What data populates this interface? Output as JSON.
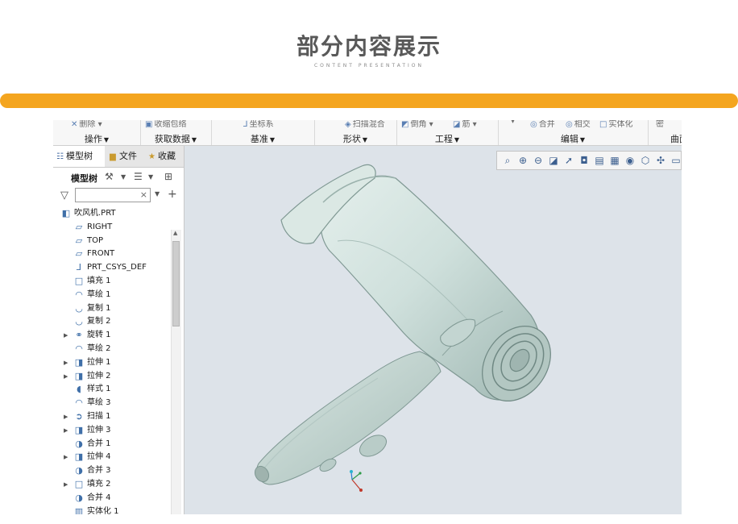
{
  "header": {
    "title": "部分内容展示",
    "subtitle": "CONTENT PRESENTATION",
    "accent_color": "#f4a51f"
  },
  "ribbon": {
    "groups": [
      {
        "label": "操作",
        "command": "删除",
        "icon": "delete-icon"
      },
      {
        "label": "获取数据",
        "command": "收缩包络",
        "icon": "shrinkwrap-icon"
      },
      {
        "label": "基准",
        "command": "坐标系",
        "icon": "csys-icon"
      },
      {
        "label": "形状",
        "command": "扫描混合",
        "icon": "swept-blend-icon"
      },
      {
        "label": "工程",
        "command": "倒角",
        "icon": "chamfer-icon",
        "command2": "筋",
        "icon2": "rib-icon"
      },
      {
        "label": "编辑",
        "command": "合并",
        "icon": "merge-icon",
        "command2": "相交",
        "icon2": "intersect-icon",
        "command3": "实体化",
        "icon3": "solidify-icon"
      },
      {
        "label": "曲面",
        "command": "密",
        "icon": "surface-icon"
      }
    ]
  },
  "panel": {
    "tabs": [
      {
        "label": "模型树",
        "icon": "model-tree-icon",
        "active": true
      },
      {
        "label": "文件",
        "icon": "folder-icon",
        "active": false
      },
      {
        "label": "收藏",
        "icon": "favorites-icon",
        "active": false
      }
    ],
    "tree_label": "模型树",
    "search": {
      "value": "",
      "placeholder": ""
    }
  },
  "tree": {
    "root": {
      "label": "吹风机.PRT",
      "icon": "part-icon"
    },
    "items": [
      {
        "label": "RIGHT",
        "icon": "datum-plane-icon",
        "expandable": false
      },
      {
        "label": "TOP",
        "icon": "datum-plane-icon",
        "expandable": false
      },
      {
        "label": "FRONT",
        "icon": "datum-plane-icon",
        "expandable": false
      },
      {
        "label": "PRT_CSYS_DEF",
        "icon": "csys-icon",
        "expandable": false
      },
      {
        "label": "填充 1",
        "icon": "fill-icon",
        "expandable": false
      },
      {
        "label": "草绘 1",
        "icon": "sketch-icon",
        "expandable": false
      },
      {
        "label": "复制 1",
        "icon": "copy-icon",
        "expandable": false
      },
      {
        "label": "复制 2",
        "icon": "copy-icon",
        "expandable": false
      },
      {
        "label": "旋转 1",
        "icon": "revolve-icon",
        "expandable": true
      },
      {
        "label": "草绘 2",
        "icon": "sketch-icon",
        "expandable": false
      },
      {
        "label": "拉伸 1",
        "icon": "extrude-icon",
        "expandable": true
      },
      {
        "label": "拉伸 2",
        "icon": "extrude-icon",
        "expandable": true
      },
      {
        "label": "样式 1",
        "icon": "style-icon",
        "expandable": false
      },
      {
        "label": "草绘 3",
        "icon": "sketch-icon",
        "expandable": false
      },
      {
        "label": "扫描 1",
        "icon": "sweep-icon",
        "expandable": true
      },
      {
        "label": "拉伸 3",
        "icon": "extrude-icon",
        "expandable": true
      },
      {
        "label": "合并 1",
        "icon": "merge-icon",
        "expandable": false
      },
      {
        "label": "拉伸 4",
        "icon": "extrude-icon",
        "expandable": true
      },
      {
        "label": "合并 3",
        "icon": "merge-icon",
        "expandable": false
      },
      {
        "label": "填充 2",
        "icon": "fill-icon",
        "expandable": true
      },
      {
        "label": "合并 4",
        "icon": "merge-icon",
        "expandable": false
      },
      {
        "label": "实体化 1",
        "icon": "solidify-icon",
        "expandable": false
      }
    ]
  },
  "view_toolbar": {
    "buttons": [
      "refit-icon",
      "zoom-in-icon",
      "zoom-out-icon",
      "repaint-icon",
      "orient-icon",
      "display-style-icon",
      "view-manager-icon",
      "saved-views-icon",
      "section-icon",
      "perspective-icon",
      "datum-display-icon",
      "annotation-icon"
    ]
  },
  "viewport": {
    "background": "#dde3e9",
    "model_color": "#cfe0dc"
  }
}
